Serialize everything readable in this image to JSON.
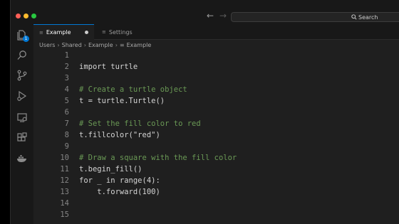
{
  "window": {
    "traffic_lights": [
      "close",
      "minimize",
      "maximize"
    ],
    "nav": {
      "back_icon": "arrow-left-icon",
      "forward_icon": "arrow-right-icon"
    },
    "search": {
      "label": "Search",
      "icon": "search-icon"
    }
  },
  "activity_bar": {
    "items": [
      {
        "name": "explorer",
        "icon": "files-icon",
        "badge": "1"
      },
      {
        "name": "search",
        "icon": "search-icon"
      },
      {
        "name": "source-control",
        "icon": "source-control-icon"
      },
      {
        "name": "run-debug",
        "icon": "run-debug-icon"
      },
      {
        "name": "remote-explorer",
        "icon": "remote-explorer-icon"
      },
      {
        "name": "extensions",
        "icon": "extensions-icon"
      },
      {
        "name": "docker",
        "icon": "docker-icon"
      }
    ]
  },
  "tabs": [
    {
      "label": "Example",
      "active": true,
      "modified": true
    },
    {
      "label": "Settings",
      "active": false
    }
  ],
  "breadcrumbs": [
    "Users",
    "Shared",
    "Example",
    "Example"
  ],
  "editor": {
    "lines": [
      {
        "n": "1",
        "text": "",
        "kind": "code"
      },
      {
        "n": "2",
        "text": "import turtle",
        "kind": "code"
      },
      {
        "n": "3",
        "text": "",
        "kind": "code"
      },
      {
        "n": "4",
        "text": "# Create a turtle object",
        "kind": "comment"
      },
      {
        "n": "5",
        "text": "t = turtle.Turtle()",
        "kind": "code"
      },
      {
        "n": "6",
        "text": "",
        "kind": "code"
      },
      {
        "n": "7",
        "text": "# Set the fill color to red",
        "kind": "comment"
      },
      {
        "n": "8",
        "text": "t.fillcolor(\"red\")",
        "kind": "code"
      },
      {
        "n": "9",
        "text": "",
        "kind": "code"
      },
      {
        "n": "10",
        "text": "# Draw a square with the fill color",
        "kind": "comment"
      },
      {
        "n": "11",
        "text": "t.begin_fill()",
        "kind": "code"
      },
      {
        "n": "12",
        "text": "for _ in range(4):",
        "kind": "code"
      },
      {
        "n": "13",
        "text": "    t.forward(100)",
        "kind": "code"
      },
      {
        "n": "14",
        "text": "",
        "kind": "code"
      },
      {
        "n": "15",
        "text": "",
        "kind": "code"
      }
    ]
  },
  "colors": {
    "background": "#1f1f1f",
    "accent": "#0078d4",
    "comment": "#6a9955",
    "line_number": "#858585"
  }
}
